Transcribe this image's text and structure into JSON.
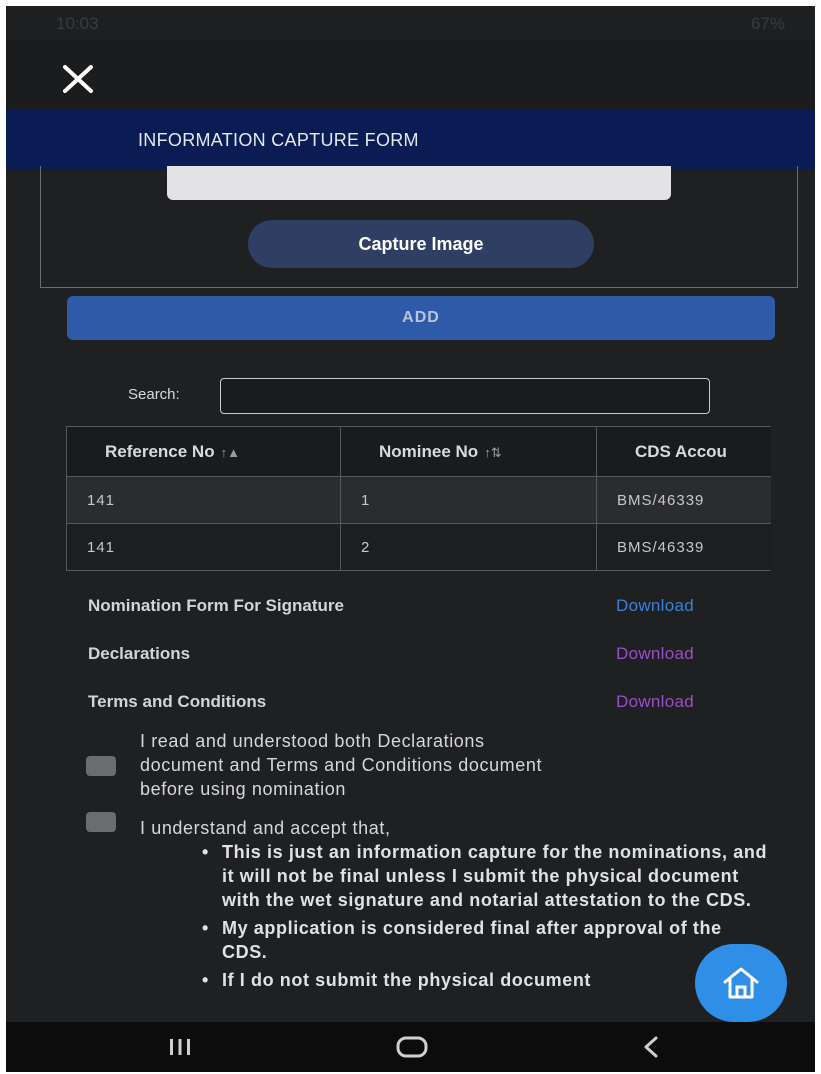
{
  "status_bar": {
    "time": "10:03",
    "battery": "67%"
  },
  "header": {
    "title": "INFORMATION CAPTURE FORM"
  },
  "capture": {
    "button_label": "Capture Image"
  },
  "add_button": "ADD",
  "search": {
    "label": "Search:",
    "value": ""
  },
  "table": {
    "headers": [
      "Reference No",
      "Nominee No",
      "CDS Accou"
    ],
    "rows": [
      [
        "141",
        "1",
        "BMS/46339"
      ],
      [
        "141",
        "2",
        "BMS/46339"
      ]
    ]
  },
  "documents": [
    {
      "label": "Nomination Form For Signature",
      "link": "Download",
      "color": "#3f7fd6"
    },
    {
      "label": "Declarations",
      "link": "Download",
      "color": "#9b4fc6"
    },
    {
      "label": "Terms and Conditions",
      "link": "Download",
      "color": "#9b4fc6"
    }
  ],
  "agreements": {
    "first_lines": [
      "I read and understood both Declarations",
      "document and Terms and Conditions document",
      "before using nomination"
    ],
    "second_intro": "I understand and accept that,",
    "bullets": [
      "This is just an information capture for the nominations, and it will not be final unless I submit the physical document with the wet signature and notarial attestation to the CDS.",
      "My application is considered final after approval of the CDS.",
      "If I do not submit the physical document"
    ]
  },
  "colors": {
    "header_bg": "#0b1b54",
    "add_bg": "#2e5aa8",
    "fab_bg": "#2f8fe6"
  },
  "icons": [
    "close-icon",
    "home-icon",
    "recent-apps-icon",
    "home-nav-icon",
    "back-icon",
    "sort-icon"
  ]
}
